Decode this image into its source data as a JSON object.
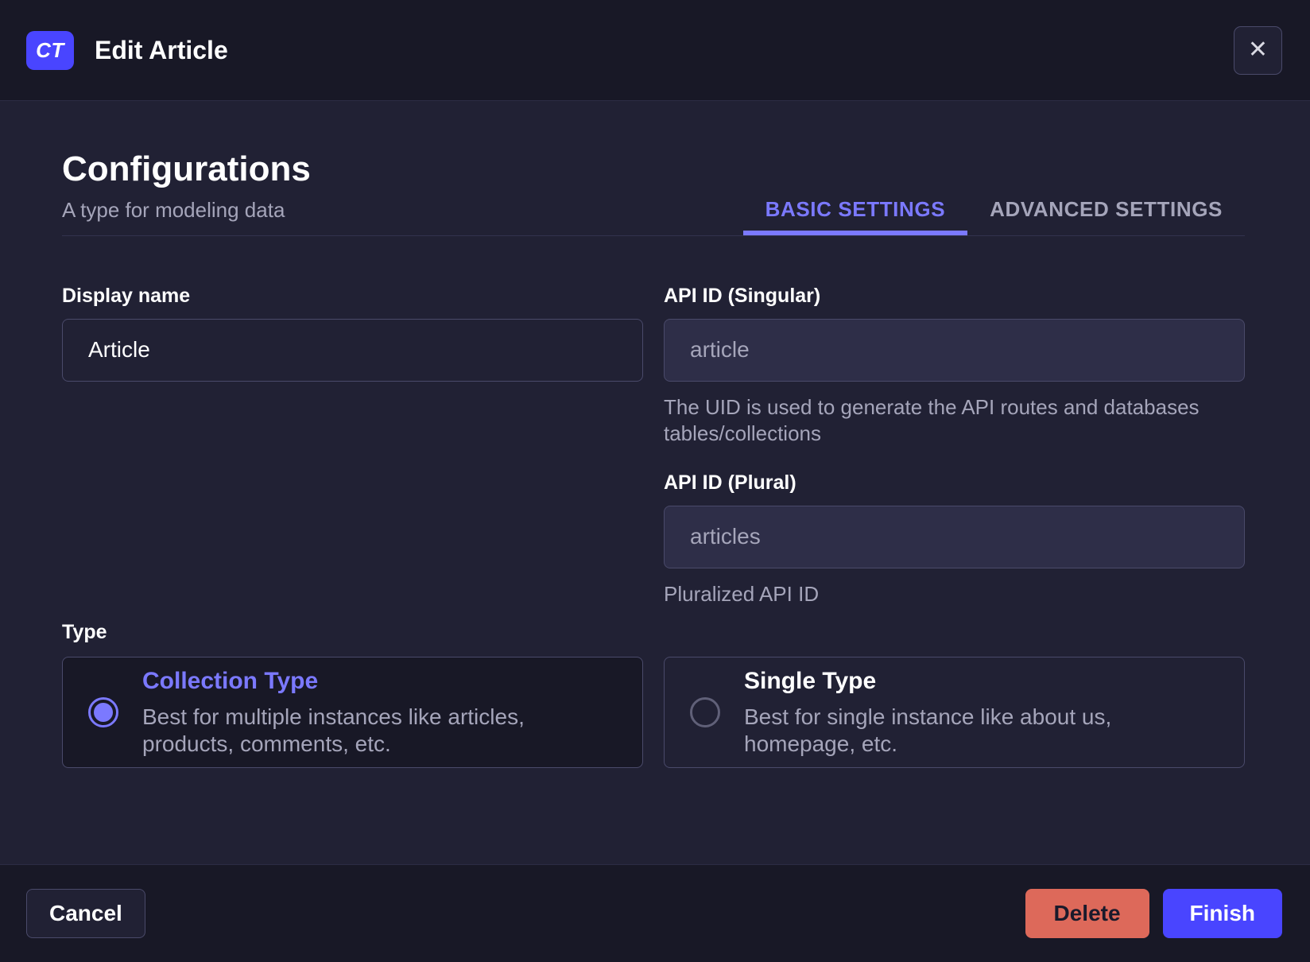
{
  "header": {
    "badge": "CT",
    "title": "Edit Article"
  },
  "icons": {
    "close": "✕"
  },
  "section": {
    "title": "Configurations",
    "subtitle": "A type for modeling data",
    "tabs": [
      {
        "label": "BASIC SETTINGS",
        "active": true
      },
      {
        "label": "ADVANCED SETTINGS",
        "active": false
      }
    ]
  },
  "form": {
    "display_name": {
      "label": "Display name",
      "value": "Article"
    },
    "api_id_singular": {
      "label": "API ID (Singular)",
      "value": "article",
      "hint": "The UID is used to generate the API routes and databases tables/collections"
    },
    "api_id_plural": {
      "label": "API ID (Plural)",
      "value": "articles",
      "hint": "Pluralized API ID"
    },
    "type": {
      "label": "Type",
      "options": [
        {
          "title": "Collection Type",
          "description": "Best for multiple instances like articles, products, comments, etc.",
          "selected": true
        },
        {
          "title": "Single Type",
          "description": "Best for single instance like about us, homepage, etc.",
          "selected": false
        }
      ]
    }
  },
  "footer": {
    "cancel_label": "Cancel",
    "delete_label": "Delete",
    "finish_label": "Finish"
  },
  "colors": {
    "accent": "#4945ff",
    "accent_light": "#7b79ff",
    "danger": "#dd695a",
    "background": "#212134",
    "surface_dark": "#181826",
    "border": "#4a4a6a",
    "text_muted": "#a5a5ba"
  }
}
